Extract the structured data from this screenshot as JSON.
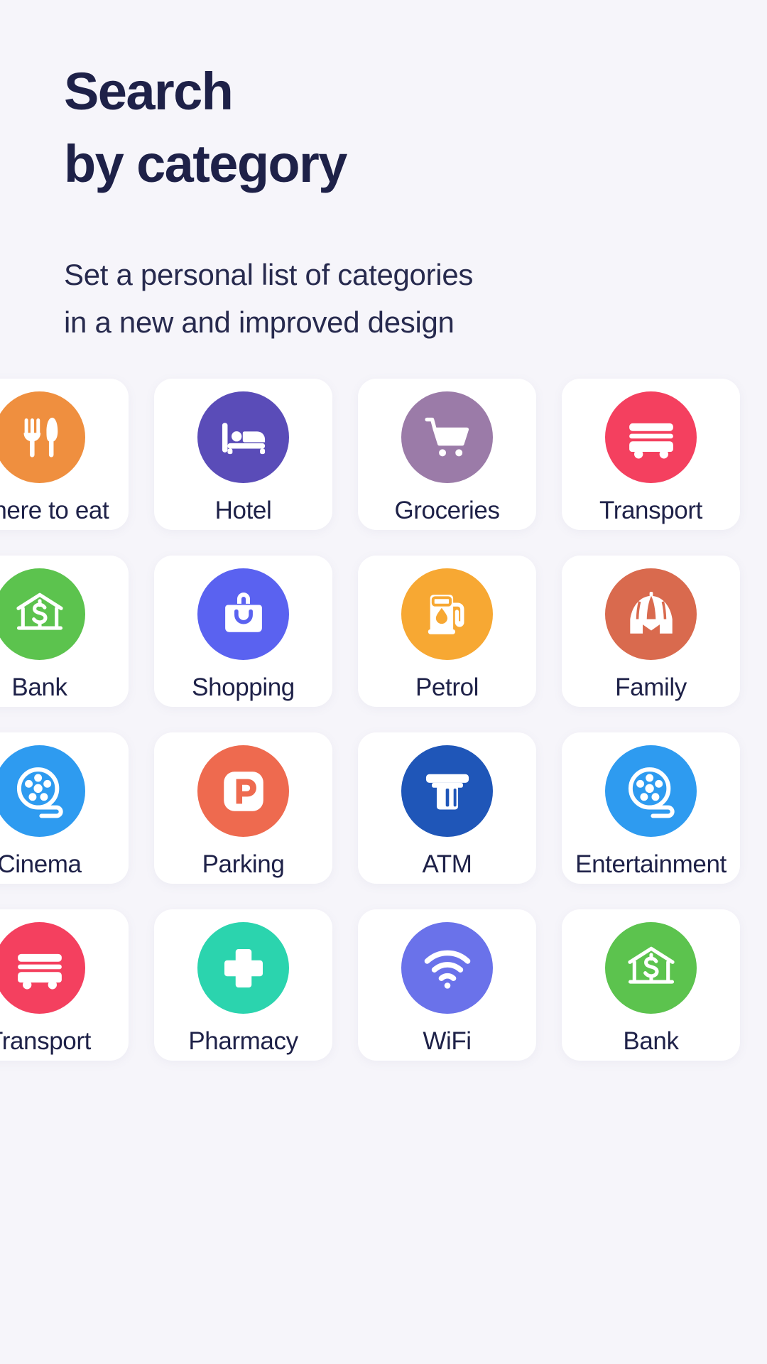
{
  "header": {
    "title_lines": [
      "Search",
      "by category"
    ],
    "subtitle_lines": [
      "Set a personal list of categories",
      "in a new and improved design"
    ]
  },
  "colors": {
    "background": "#f6f5fa",
    "card": "#ffffff",
    "text": "#1e2148"
  },
  "grid": {
    "columns": 4,
    "rows": 4,
    "tiles": [
      {
        "label": "Where to eat",
        "icon": "cutlery-icon",
        "color": "#ef8f3f"
      },
      {
        "label": "Hotel",
        "icon": "bed-icon",
        "color": "#5a4cb8"
      },
      {
        "label": "Groceries",
        "icon": "shopping-cart-icon",
        "color": "#9b7ba8"
      },
      {
        "label": "Transport",
        "icon": "bus-icon",
        "color": "#f4405f"
      },
      {
        "label": "Bank",
        "icon": "bank-dollar-icon",
        "color": "#5cc34e"
      },
      {
        "label": "Shopping",
        "icon": "shopping-bag-icon",
        "color": "#5a62f0"
      },
      {
        "label": "Petrol",
        "icon": "fuel-pump-icon",
        "color": "#f7a833"
      },
      {
        "label": "Family",
        "icon": "circus-tent-icon",
        "color": "#d96a4e"
      },
      {
        "label": "Cinema",
        "icon": "film-reel-icon",
        "color": "#2e9bf0"
      },
      {
        "label": "Parking",
        "icon": "parking-p-icon",
        "color": "#ee6a4f"
      },
      {
        "label": "ATM",
        "icon": "atm-icon",
        "color": "#1f56b8"
      },
      {
        "label": "Entertainment",
        "icon": "film-reel-icon",
        "color": "#2e9bf0"
      },
      {
        "label": "Transport",
        "icon": "bus-icon",
        "color": "#f4405f"
      },
      {
        "label": "Pharmacy",
        "icon": "medical-cross-icon",
        "color": "#2bd4ae"
      },
      {
        "label": "WiFi",
        "icon": "wifi-icon",
        "color": "#6a72ea"
      },
      {
        "label": "Bank",
        "icon": "bank-dollar-icon",
        "color": "#5cc34e"
      }
    ]
  }
}
